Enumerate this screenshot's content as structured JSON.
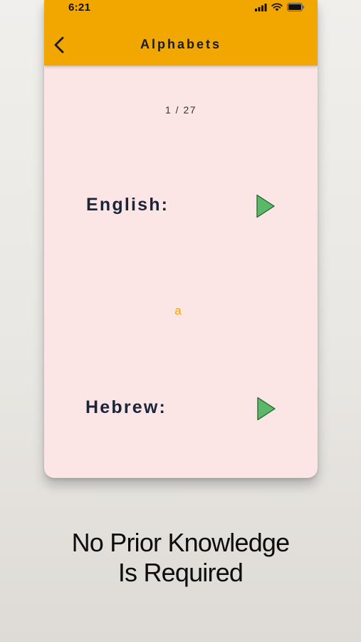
{
  "status_bar": {
    "time": "6:21",
    "icons": [
      "signal-icon",
      "wifi-icon",
      "battery-icon"
    ]
  },
  "header": {
    "back_icon": "chevron-left-icon",
    "title": "Alphabets"
  },
  "card": {
    "counter": "1 / 27",
    "english_label": "English:",
    "letter": "a",
    "hebrew_label": "Hebrew:",
    "play_icon": "play-icon"
  },
  "promo": {
    "line1": "No Prior Knowledge",
    "line2": "Is Required"
  },
  "colors": {
    "header": "#f2a600",
    "card_background": "#fbe5e5",
    "play_fill": "#5bb868",
    "label_text": "#1b2538",
    "letter_text": "#f2a600"
  }
}
